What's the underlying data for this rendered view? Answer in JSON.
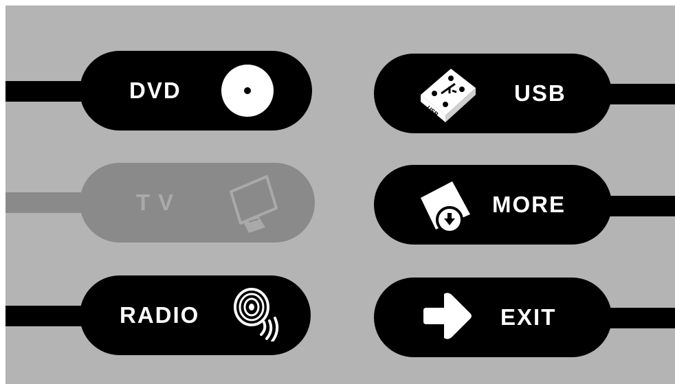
{
  "menu": {
    "dvd": {
      "label": "DVD",
      "icon": "disc-icon",
      "enabled": true
    },
    "tv": {
      "label": "TV",
      "icon": "monitor-icon",
      "enabled": false
    },
    "radio": {
      "label": "RADIO",
      "icon": "radio-wave-icon",
      "enabled": true
    },
    "usb": {
      "label": "USB",
      "icon": "usb-drive-icon",
      "enabled": true,
      "icon_text": "USB"
    },
    "more": {
      "label": "MORE",
      "icon": "download-icon",
      "enabled": true
    },
    "exit": {
      "label": "EXIT",
      "icon": "exit-arrow-icon",
      "enabled": true
    }
  },
  "colors": {
    "background": "#b4b4b4",
    "button": "#000000",
    "button_disabled": "#8a8a8a",
    "label": "#ffffff",
    "label_disabled": "#a9a9a9"
  }
}
